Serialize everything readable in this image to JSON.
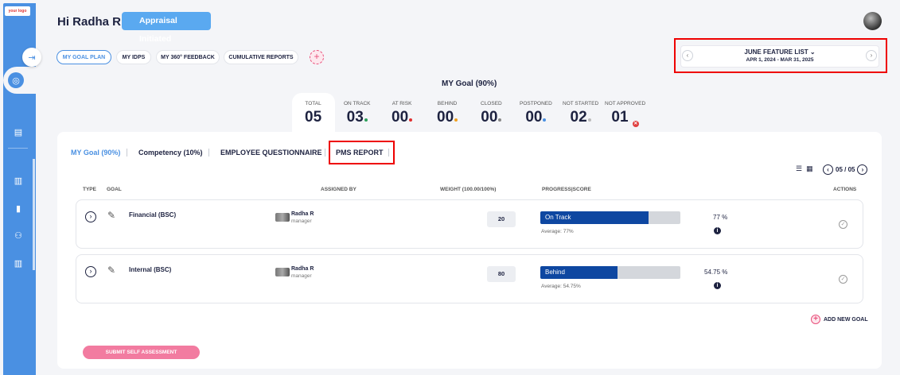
{
  "app": {
    "logo_text": "your logo"
  },
  "header": {
    "greeting": "Hi Radha R",
    "status_badge": "Appraisal Initiated"
  },
  "tabs": [
    {
      "label": "MY GOAL PLAN",
      "active": true
    },
    {
      "label": "MY IDPS"
    },
    {
      "label": "MY 360° FEEDBACK"
    },
    {
      "label": "CUMULATIVE REPORTS"
    }
  ],
  "feature_list": {
    "title": "JUNE FEATURE LIST",
    "date_range": "APR 1, 2024 - MAR 31, 2025"
  },
  "goal_summary": {
    "heading": "MY Goal (90%)",
    "stats": [
      {
        "label": "TOTAL",
        "value": "05"
      },
      {
        "label": "ON TRACK",
        "value": "03",
        "color": "#2ca05a"
      },
      {
        "label": "AT RISK",
        "value": "00",
        "color": "#e03030"
      },
      {
        "label": "BEHIND",
        "value": "00",
        "color": "#f0a020"
      },
      {
        "label": "CLOSED",
        "value": "00",
        "color": "#888888"
      },
      {
        "label": "POSTPONED",
        "value": "00",
        "color": "#4a90e2"
      },
      {
        "label": "NOT STARTED",
        "value": "02",
        "color": "#bbbbbb"
      },
      {
        "label": "NOT APPROVED",
        "value": "01",
        "color": "#e04040"
      }
    ]
  },
  "subtabs": [
    {
      "label": "MY Goal (90%)",
      "active": true
    },
    {
      "label": "Competency (10%)"
    },
    {
      "label": "EMPLOYEE QUESTIONNAIRE"
    },
    {
      "label": "PMS REPORT"
    }
  ],
  "pager": {
    "text": "05 / 05"
  },
  "table": {
    "columns": [
      "TYPE",
      "GOAL",
      "ASSIGNED BY",
      "WEIGHT (100.00/100%)",
      "PROGRESS|SCORE",
      "ACTIONS"
    ],
    "rows": [
      {
        "goal": "Financial (BSC)",
        "assigned_by": "Radha R",
        "role": "manager",
        "weight": "20",
        "status": "On Track",
        "progress_fraction": 0.77,
        "average": "Average: 77%",
        "score": "77  %"
      },
      {
        "goal": "Internal (BSC)",
        "assigned_by": "Radha R",
        "role": "manager",
        "weight": "80",
        "status": "Behind",
        "progress_fraction": 0.55,
        "average": "Average: 54.75%",
        "score": "54.75  %"
      }
    ]
  },
  "actions": {
    "add_goal": "ADD NEW GOAL",
    "submit": "SUBMIT SELF ASSESSMENT"
  }
}
